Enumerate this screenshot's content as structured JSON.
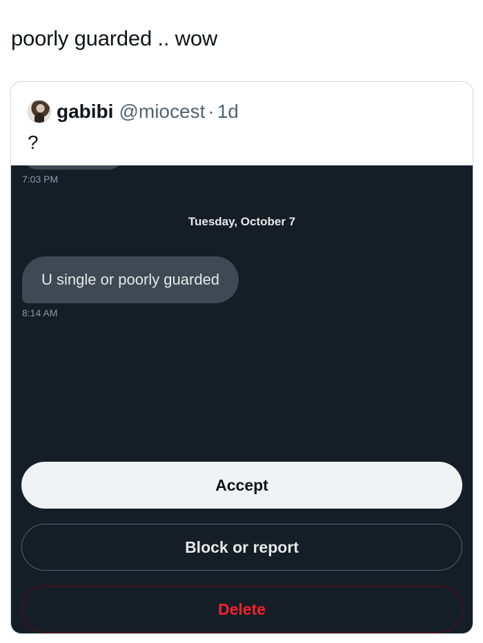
{
  "post": {
    "caption": "poorly guarded .. wow"
  },
  "quoted_post": {
    "display_name": "gabibi",
    "handle": "@miocest",
    "separator": "·",
    "age": "1d",
    "text": "?"
  },
  "dm_screenshot": {
    "earlier_time": "7:03 PM",
    "date_divider": "Tuesday, October 7",
    "message": {
      "text": "U single or poorly guarded",
      "time": "8:14 AM"
    },
    "actions": {
      "accept_label": "Accept",
      "block_label": "Block or report",
      "delete_label": "Delete"
    }
  },
  "colors": {
    "dm_background": "#151e27",
    "bubble": "#3e4955",
    "delete_red": "#f4212e",
    "accept_bg": "#eff3f4"
  }
}
